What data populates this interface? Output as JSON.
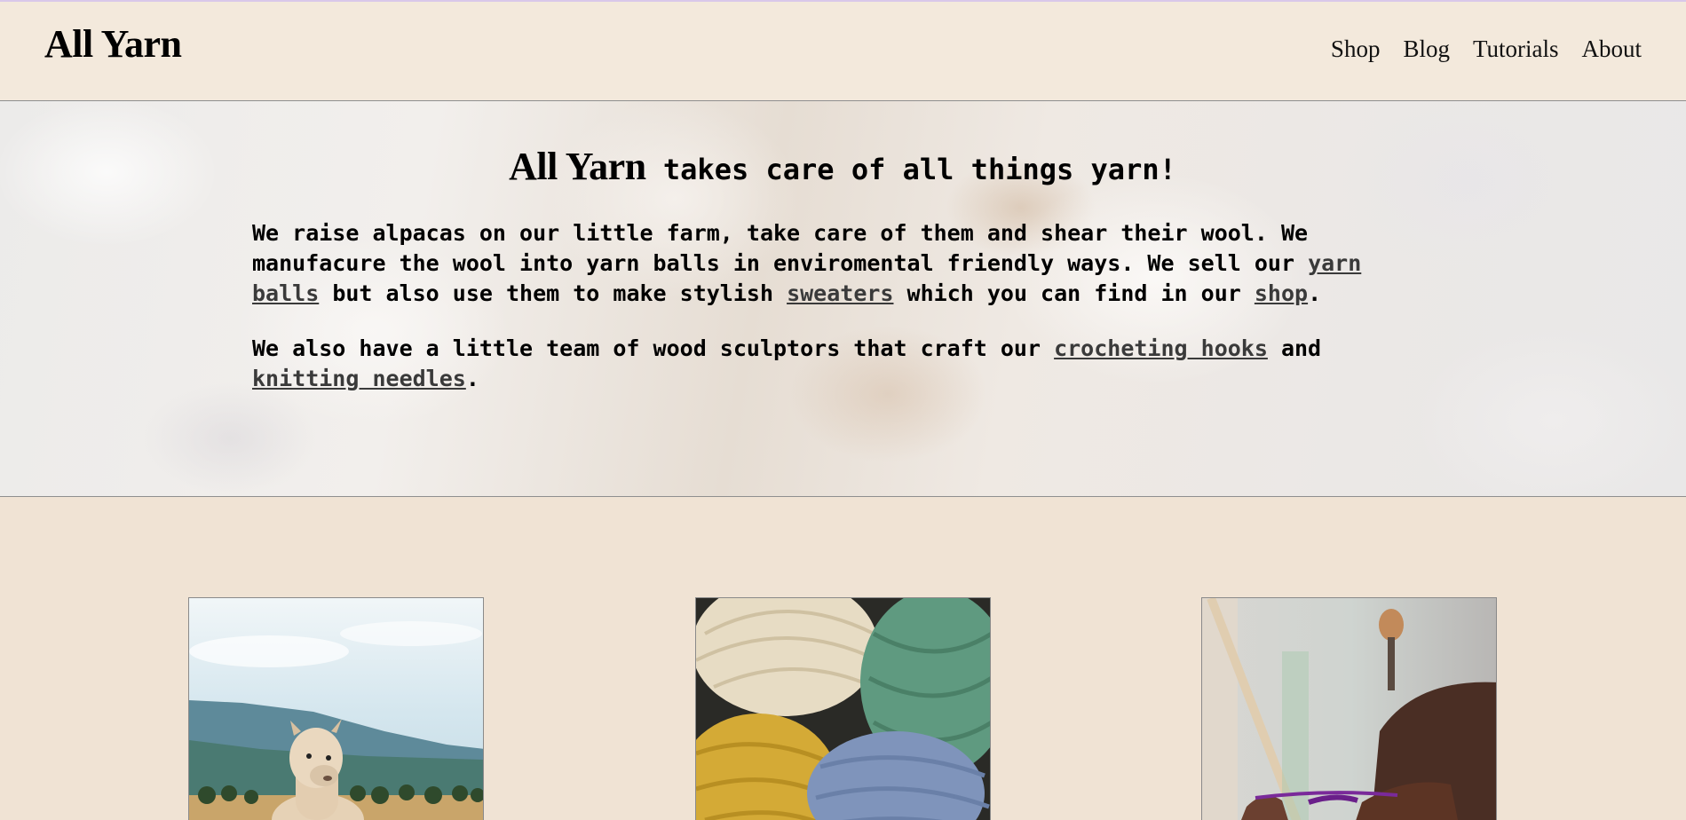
{
  "header": {
    "brand": "All Yarn",
    "nav": [
      "Shop",
      "Blog",
      "Tutorials",
      "About"
    ]
  },
  "hero": {
    "title_brand": "All Yarn",
    "title_rest": " takes care of all things yarn!",
    "para1": {
      "text1": "We raise alpacas on our little farm, take care of them and shear their wool. We manufacure the wool into yarn balls in enviromental friendly ways. We sell our ",
      "link1": "yarn balls",
      "text2": " but also use them to make stylish ",
      "link2": "sweaters",
      "text3": " which you can find in our ",
      "link3": "shop",
      "text4": "."
    },
    "para2": {
      "text1": "We also have a little team of wood sculptors that craft our ",
      "link1": "crocheting hooks",
      "text2": " and ",
      "link2": "knitting needles",
      "text3": "."
    }
  },
  "cards": [
    {
      "image": "alpaca-photo"
    },
    {
      "image": "yarn-balls-photo"
    },
    {
      "image": "crocheting-photo"
    }
  ],
  "colors": {
    "page_bg": "#f0e3d4",
    "header_bg": "#f3e9dc",
    "link": "#3a3a3a"
  }
}
